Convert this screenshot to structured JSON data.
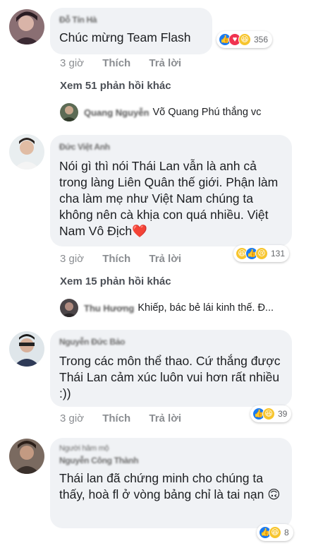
{
  "comments": [
    {
      "author": "Đỗ Tín Hà",
      "text": "Chúc mừng Team Flash",
      "reactions": [
        "like",
        "love",
        "haha"
      ],
      "reaction_count": "356",
      "time": "3 giờ",
      "like_label": "Thích",
      "reply_label": "Trả lời",
      "more_replies": "Xem 51 phản hồi khác",
      "reply_preview": {
        "name": "Quang Nguyễn",
        "text": "Võ Quang Phú thắng vc"
      }
    },
    {
      "author": "Đức Việt Anh",
      "text": "Nói gì thì nói Thái Lan vẫn là anh cả trong làng Liên Quân thế giới. Phận làm cha làm mẹ như Việt Nam chúng ta không nên cà khịa con quá nhiều. Việt Nam Vô Địch❤️",
      "reactions": [
        "haha",
        "like",
        "sad"
      ],
      "reaction_count": "131",
      "time": "3 giờ",
      "like_label": "Thích",
      "reply_label": "Trả lời",
      "more_replies": "Xem 15 phản hồi khác",
      "reply_preview": {
        "name": "Thu Hương",
        "text": "Khiếp, bác bẻ lái kinh thế. Đ..."
      }
    },
    {
      "author": "Nguyễn Đức Bảo",
      "text": "Trong các môn thể thao. Cứ thắng được Thái Lan cảm xúc luôn vui hơn rất nhiều :))",
      "reactions": [
        "like",
        "haha"
      ],
      "reaction_count": "39",
      "time": "3 giờ",
      "like_label": "Thích",
      "reply_label": "Trả lời"
    },
    {
      "author": "Nguyễn Công Thành",
      "badge": "Người hâm mộ",
      "text": "Thái lan đã chứng minh cho chúng ta thấy, hoà fl ở vòng bảng chỉ là tai nạn 🙃",
      "reactions": [
        "like",
        "haha"
      ],
      "reaction_count": "8"
    }
  ]
}
